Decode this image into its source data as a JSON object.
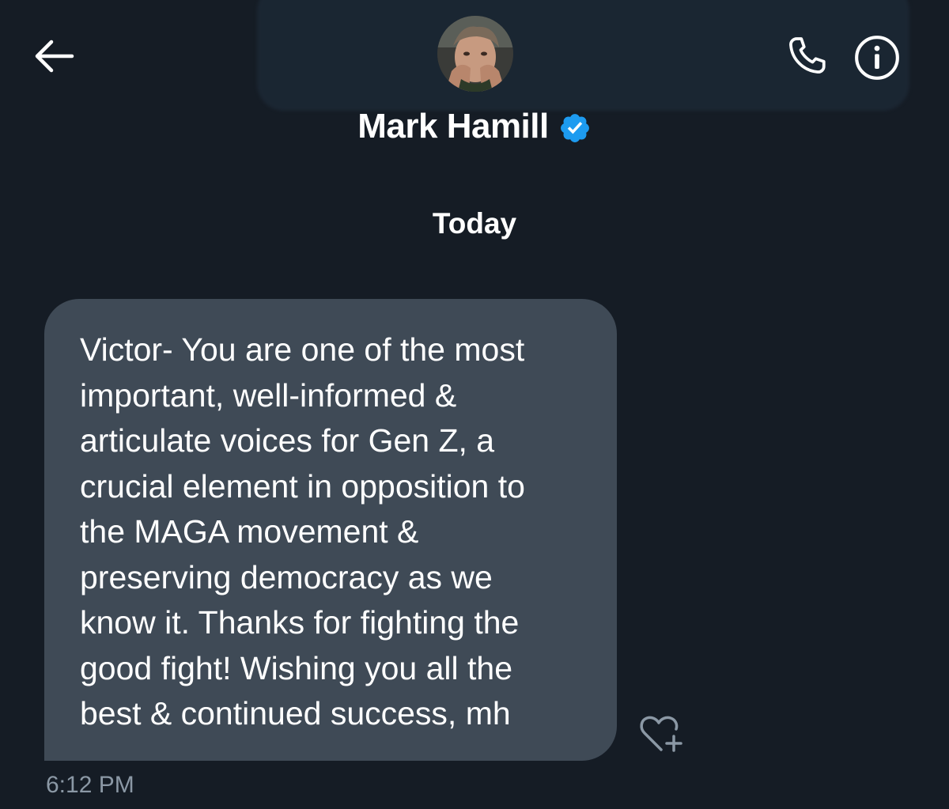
{
  "header": {
    "back_icon": "arrow-left-icon",
    "name": "Mark Hamill",
    "verified_icon": "verified-badge-icon",
    "verified_color": "#1d9bf0",
    "call_icon": "phone-icon",
    "info_icon": "info-icon"
  },
  "conversation": {
    "date_separator": "Today",
    "messages": [
      {
        "text": "Victor- You are one of the most\nimportant, well-informed &\narticulate voices for Gen Z, a\ncrucial element in opposition to\nthe MAGA movement &\npreserving democracy as we\nknow it. Thanks for fighting the\ngood fight! Wishing you all the\nbest & continued success, mh",
        "time": "6:12 PM",
        "reaction_icon": "heart-plus-icon"
      }
    ]
  },
  "colors": {
    "background": "#151c25",
    "bubble": "#3f4a56",
    "timestamp": "#8b98a5"
  }
}
